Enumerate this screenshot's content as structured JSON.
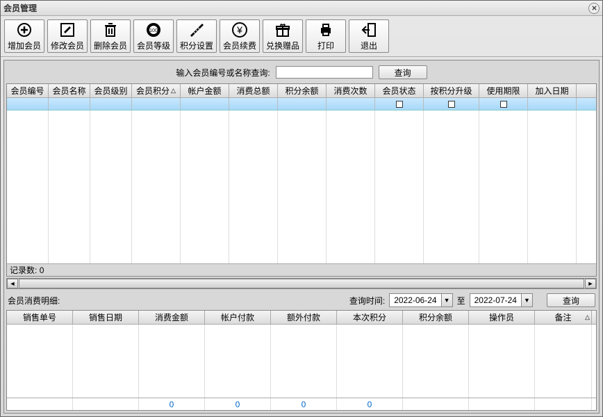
{
  "window": {
    "title": "会员管理"
  },
  "toolbar": {
    "add": "增加会员",
    "edit": "修改会员",
    "delete": "删除会员",
    "level": "会员等级",
    "points": "积分设置",
    "renew": "会员续费",
    "gift": "兑换赠品",
    "print": "打印",
    "exit": "退出"
  },
  "search": {
    "label": "输入会员编号或名称查询:",
    "value": "",
    "btn": "查询"
  },
  "grid1": {
    "cols": [
      "会员编号",
      "会员名称",
      "会员级别",
      "会员积分",
      "帐户金额",
      "消费总额",
      "积分余额",
      "消费次数",
      "会员状态",
      "按积分升级",
      "使用期限",
      "加入日期"
    ],
    "sort_col": 3,
    "record_label": "记录数:",
    "record_count": "0"
  },
  "detail": {
    "title": "会员消费明细:",
    "time_label": "查询时间:",
    "date_from": "2022-06-24",
    "to": "至",
    "date_to": "2022-07-24",
    "btn": "查询"
  },
  "grid2": {
    "cols": [
      "销售单号",
      "销售日期",
      "消费金额",
      "帐户付款",
      "额外付款",
      "本次积分",
      "积分余额",
      "操作员",
      "备注"
    ],
    "footer": [
      "",
      "",
      "0",
      "0",
      "0",
      "0",
      "",
      "",
      ""
    ]
  }
}
